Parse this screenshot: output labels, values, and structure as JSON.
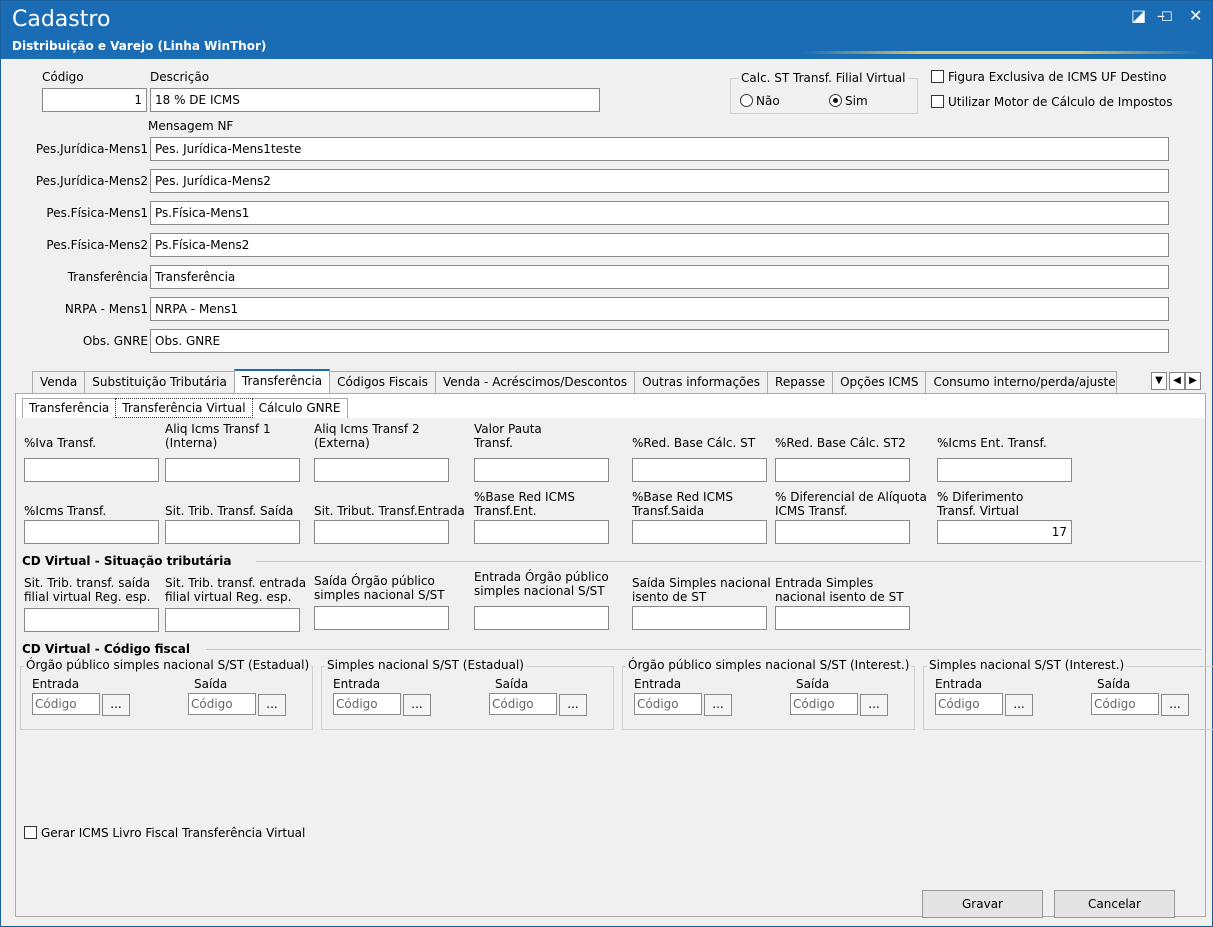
{
  "window": {
    "title": "Cadastro",
    "subtitle": "Distribuição e Varejo (Linha WinThor)",
    "restore_glyph": "◪",
    "minimize_glyph": "–",
    "maximize_glyph": "☐",
    "close_glyph": "✕"
  },
  "header": {
    "codigo_label": "Código",
    "codigo_value": "1",
    "descricao_label": "Descrição",
    "descricao_value": "18 % DE ICMS",
    "calc_st_label": "Calc. ST Transf. Filial Virtual",
    "radio_nao": "Não",
    "radio_sim": "Sim",
    "selected": "Sim",
    "check_figura": "Figura Exclusiva de ICMS UF Destino",
    "check_motor": "Utilizar Motor de Cálculo de Impostos",
    "mensagem_label": "Mensagem NF"
  },
  "messages": [
    {
      "label": "Pes.Jurídica-Mens1",
      "value": "Pes. Jurídica-Mens1teste"
    },
    {
      "label": "Pes.Jurídica-Mens2",
      "value": "Pes. Jurídica-Mens2"
    },
    {
      "label": "Pes.Física-Mens1",
      "value": "Ps.Física-Mens1"
    },
    {
      "label": "Pes.Física-Mens2",
      "value": "Ps.Física-Mens2"
    },
    {
      "label": "Transferência",
      "value": "Transferência"
    },
    {
      "label": "NRPA - Mens1",
      "value": "NRPA - Mens1"
    },
    {
      "label": "Obs. GNRE",
      "value": "Obs. GNRE"
    }
  ],
  "tabs": [
    "Venda",
    "Substituição Tributária",
    "Transferência",
    "Códigos Fiscais",
    "Venda - Acréscimos/Descontos",
    "Outras informações",
    "Repasse",
    "Opções ICMS",
    "Consumo interno/perda/ajuste"
  ],
  "active_tab": "Transferência",
  "subtabs": [
    "Transferência",
    "Transferência Virtual",
    "Cálculo GNRE"
  ],
  "active_subtab": "Transferência Virtual",
  "fields": {
    "iva": "%Iva Transf.",
    "aliq1": "Aliq Icms Transf 1 (Interna)",
    "aliq2": "Aliq Icms Transf 2 (Externa)",
    "pauta": "Valor Pauta Transf.",
    "redbase1": "%Red. Base Cálc. ST",
    "redbase2": "%Red. Base Cálc. ST2",
    "icmsent": "%Icms Ent. Transf.",
    "icms": "%Icms Transf.",
    "sit_saida": "Sit. Trib. Transf. Saída",
    "sit_entrada": "Sit. Tribut. Transf.Entrada",
    "base_red_ent": "%Base Red ICMS Transf.Ent.",
    "base_red_saida": "%Base Red ICMS Transf.Saida",
    "diferencial": "% Diferencial de Alíquota ICMS Transf.",
    "diferimento": "% Diferimento Transf. Virtual",
    "diferimento_value": "17"
  },
  "cd_situacao": {
    "title": "CD Virtual - Situação tributária",
    "f1": "Sit. Trib. transf. saída filial virtual Reg. esp.",
    "f2": "Sit. Trib. transf. entrada filial virtual Reg. esp.",
    "f3": "Saída Órgão público simples nacional S/ST",
    "f4": "Entrada Órgão público simples nacional S/ST",
    "f5": "Saída Simples nacional isento de ST",
    "f6": "Entrada Simples nacional isento de ST"
  },
  "cd_codigo": {
    "title": "CD Virtual - Código fiscal",
    "groups": [
      {
        "title": "Órgão público simples nacional S/ST (Estadual)"
      },
      {
        "title": "Simples nacional S/ST (Estadual)"
      },
      {
        "title": "Órgão público simples nacional S/ST (Interest.)"
      },
      {
        "title": "Simples nacional S/ST (Interest.)"
      }
    ],
    "entrada": "Entrada",
    "saida": "Saída",
    "placeholder": "Código",
    "ellipsis": "..."
  },
  "gerar_label": "Gerar ICMS Livro Fiscal Transferência Virtual",
  "buttons": {
    "save": "Gravar",
    "cancel": "Cancelar"
  },
  "scroll": {
    "down": "▼",
    "left": "◀",
    "right": "▶"
  }
}
